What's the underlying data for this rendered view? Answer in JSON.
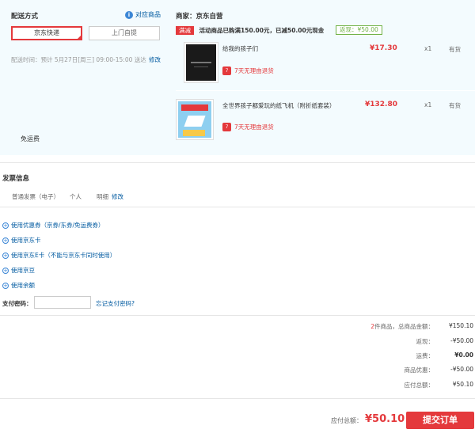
{
  "delivery": {
    "title": "配送方式",
    "match_products_link": "对应商品",
    "options": [
      "京东快递",
      "上门自提"
    ],
    "time_label": "配送时间：预计 5月27日[周三] 09:00-15:00 送达",
    "modify_link": "修改",
    "freight": "免运费"
  },
  "shop": {
    "merchant": "商家：京东自营",
    "promo_tag": "满减",
    "promo_text": "活动商品已购满150.00元，已减50.00元现金",
    "savings": "返现：¥50.00",
    "products": [
      {
        "name": "给我的孩子们",
        "price": "¥17.30",
        "qty": "x1",
        "stock": "有货",
        "refund": "7天无理由退货"
      },
      {
        "name": "全世界孩子都爱玩的纸飞机（附折纸套装）",
        "price": "¥132.80",
        "qty": "x1",
        "stock": "有货",
        "refund": "7天无理由退货"
      }
    ]
  },
  "invoice": {
    "title": "发票信息",
    "type": "普通发票（电子）",
    "person": "个人",
    "detail": "明细",
    "modify_link": "修改"
  },
  "options": [
    "使用优惠券（京券/东券/免运费券）",
    "使用京东卡",
    "使用京东E卡（不能与京东卡同时使用）",
    "使用京豆",
    "使用余额"
  ],
  "password": {
    "label": "支付密码：",
    "forgot_link": "忘记支付密码?"
  },
  "summary": {
    "count_prefix": "2",
    "count_suffix": "件商品，总商品金额：",
    "goods_total": "¥150.10",
    "rebate_label": "返现：",
    "rebate": "-¥50.00",
    "freight_label": "运费：",
    "freight": "¥0.00",
    "discount_label": "商品优惠：",
    "discount": "-¥50.00",
    "payable_label": "应付总额：",
    "payable": "¥50.10"
  },
  "footer": {
    "total_label": "应付总额：",
    "total": "¥50.10",
    "submit": "提交订单"
  },
  "colors": {
    "accent_red": "#e4393c",
    "link_blue": "#005aa0",
    "panel_bg": "#f3fbfe",
    "savings_green": "#71b247"
  },
  "icons": [
    "info-icon",
    "check-icon",
    "refund-icon",
    "plus-circle-icon"
  ]
}
